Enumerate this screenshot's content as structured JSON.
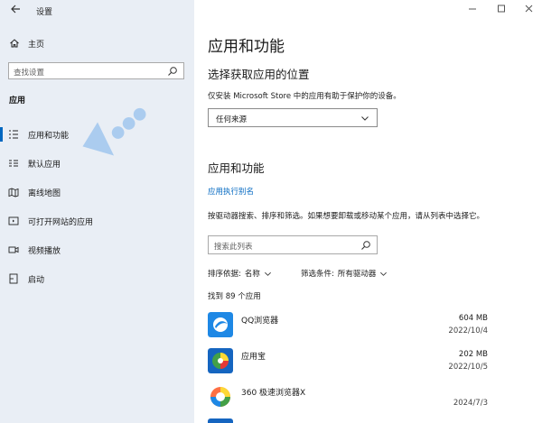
{
  "window": {
    "title": "设置"
  },
  "sidebar": {
    "home_label": "主页",
    "search_placeholder": "查找设置",
    "section_title": "应用",
    "items": [
      {
        "label": "应用和功能",
        "icon": "apps-features-icon",
        "active": true
      },
      {
        "label": "默认应用",
        "icon": "default-apps-icon",
        "active": false
      },
      {
        "label": "离线地图",
        "icon": "offline-maps-icon",
        "active": false
      },
      {
        "label": "可打开网站的应用",
        "icon": "apps-for-websites-icon",
        "active": false
      },
      {
        "label": "视频播放",
        "icon": "video-playback-icon",
        "active": false
      },
      {
        "label": "启动",
        "icon": "startup-icon",
        "active": false
      }
    ]
  },
  "main": {
    "page_title": "应用和功能",
    "install_section": {
      "heading": "选择获取应用的位置",
      "description": "仅安装 Microsoft Store 中的应用有助于保护你的设备。",
      "dropdown_value": "任何来源"
    },
    "apps_section": {
      "heading": "应用和功能",
      "alias_link": "应用执行别名",
      "hint": "按驱动器搜索、排序和筛选。如果想要卸载或移动某个应用，请从列表中选择它。",
      "search_placeholder": "搜索此列表",
      "sort_label": "排序依据:",
      "sort_value": "名称",
      "filter_label": "筛选条件:",
      "filter_value": "所有驱动器",
      "count_text": "找到 89 个应用",
      "apps": [
        {
          "name": "QQ浏览器",
          "size": "604 MB",
          "date": "2022/10/4",
          "icon": "qq-browser-icon"
        },
        {
          "name": "应用宝",
          "size": "202 MB",
          "date": "2022/10/5",
          "icon": "yingyongbao-icon"
        },
        {
          "name": "360 极速浏览器X",
          "size": "",
          "date": "2024/7/3",
          "icon": "360-browser-icon"
        }
      ]
    }
  },
  "colors": {
    "accent": "#0067c0",
    "sidebar_bg": "#e9eef5"
  }
}
